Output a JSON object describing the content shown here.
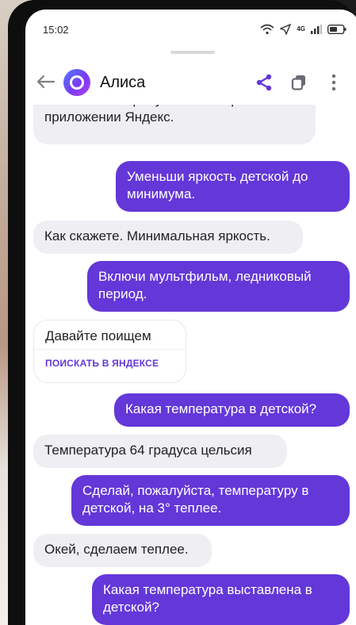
{
  "status": {
    "time": "15:02",
    "network": "4G"
  },
  "header": {
    "title": "Алиса"
  },
  "messages": [
    {
      "side": "in",
      "text": "отвечают. Попробуйте посмотреть в приложении Яндекс."
    },
    {
      "side": "out",
      "text": "Уменьши яркость детской до минимума."
    },
    {
      "side": "in",
      "text": "Как скажете. Минимальная яркость."
    },
    {
      "side": "out",
      "text": "Включи мультфильм, ледниковый период."
    },
    {
      "side": "in",
      "text": "Давайте поищем",
      "link": "ПОИСКАТЬ В ЯНДЕКСЕ"
    },
    {
      "side": "out",
      "text": "Какая температура в детской?"
    },
    {
      "side": "in",
      "text": "Температура 64 градуса цельсия"
    },
    {
      "side": "out",
      "text": "Сделай, пожалуйста, температуру в детской, на 3° теплее."
    },
    {
      "side": "in",
      "text": "Окей, сделаем теплее."
    },
    {
      "side": "out",
      "text": "Какая температура выставлена в детской?"
    }
  ],
  "colors": {
    "accent": "#6437d8",
    "incoming": "#efeef3"
  }
}
